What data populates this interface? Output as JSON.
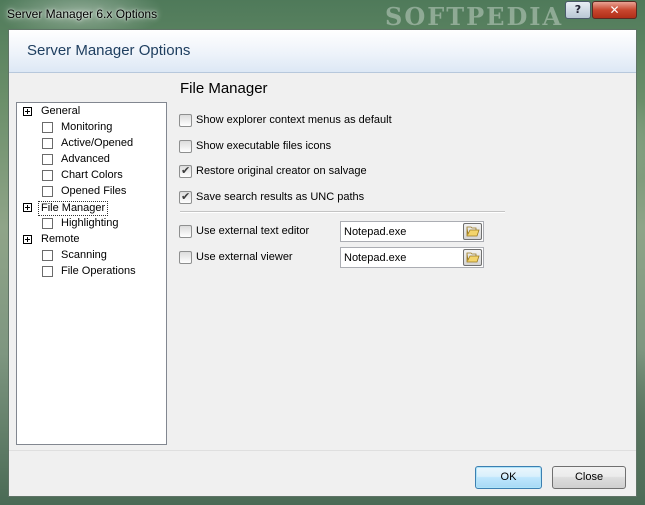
{
  "window": {
    "title": "Server Manager 6.x Options",
    "watermark": "SOFTPEDIA",
    "help_label": "?",
    "close_label": "✕"
  },
  "header": {
    "title": "Server Manager Options"
  },
  "tree": {
    "items": [
      {
        "label": "General",
        "type": "parent"
      },
      {
        "label": "Monitoring",
        "type": "child"
      },
      {
        "label": "Active/Opened",
        "type": "child"
      },
      {
        "label": "Advanced",
        "type": "child"
      },
      {
        "label": "Chart Colors",
        "type": "child"
      },
      {
        "label": "Opened Files",
        "type": "child"
      },
      {
        "label": "File Manager",
        "type": "parent",
        "selected": true
      },
      {
        "label": "Highlighting",
        "type": "child"
      },
      {
        "label": "Remote",
        "type": "parent"
      },
      {
        "label": "Scanning",
        "type": "child"
      },
      {
        "label": "File Operations",
        "type": "child"
      }
    ]
  },
  "section": {
    "title": "File Manager"
  },
  "options": [
    {
      "label": "Show explorer context menus as default",
      "checked": false
    },
    {
      "label": "Show executable files icons",
      "checked": false
    },
    {
      "label": "Restore original creator on salvage",
      "checked": true
    },
    {
      "label": "Save search results as UNC paths",
      "checked": true
    }
  ],
  "external": [
    {
      "label": "Use external text editor",
      "checked": false,
      "value": "Notepad.exe"
    },
    {
      "label": "Use external viewer",
      "checked": false,
      "value": "Notepad.exe"
    }
  ],
  "buttons": {
    "ok": "OK",
    "close": "Close"
  },
  "icons": {
    "tree_expander": "plus-box-icon",
    "browse": "folder-open-icon"
  },
  "colors": {
    "header_text": "#1f3f60",
    "default_button_border": "#3c7fb1",
    "close_button": "#c8472f"
  }
}
